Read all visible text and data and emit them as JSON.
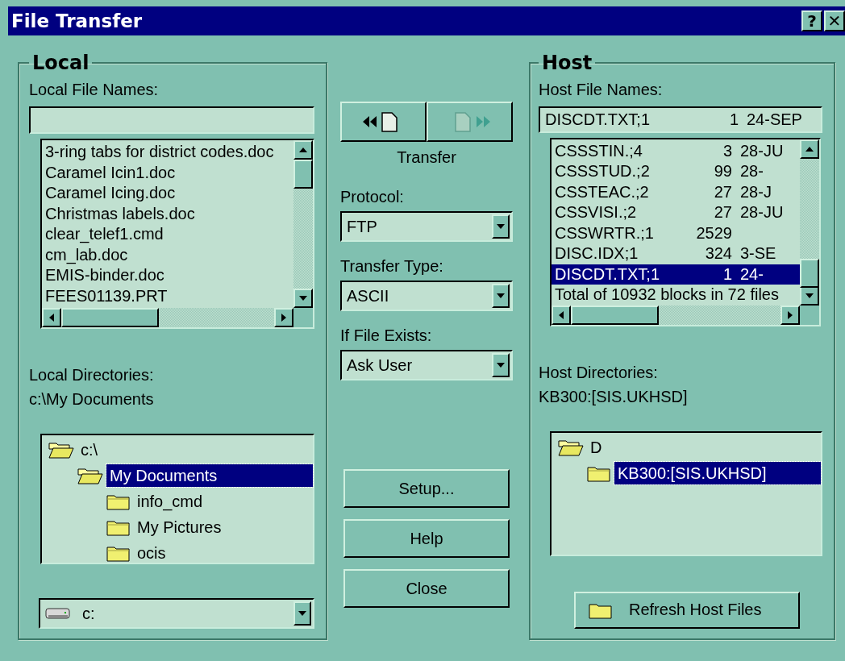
{
  "window": {
    "title": "File Transfer",
    "buttons": [
      "?",
      "✕"
    ]
  },
  "local": {
    "title": "Local",
    "file_names_label": "Local File Names:",
    "files": [
      {
        "name": "3-ring tabs for district codes.doc",
        "selected": false
      },
      {
        "name": "Caramel Icin1.doc",
        "selected": false
      },
      {
        "name": "Caramel Icing.doc",
        "selected": false
      },
      {
        "name": "Christmas labels.doc",
        "selected": false
      },
      {
        "name": "clear_telef1.cmd",
        "selected": false
      },
      {
        "name": "cm_lab.doc",
        "selected": false
      },
      {
        "name": "EMIS-binder.doc",
        "selected": false
      },
      {
        "name": "FEES01139.PRT",
        "selected": false
      }
    ],
    "directories_label": "Local Directories:",
    "current_directory": "c:\\My Documents",
    "tree": [
      {
        "name": "c:\\",
        "expanded": true,
        "selected": false,
        "children": [
          {
            "name": "My Documents",
            "expanded": true,
            "selected": true,
            "children": [
              {
                "name": "info_cmd",
                "expanded": false,
                "selected": false
              },
              {
                "name": "My Pictures",
                "expanded": false,
                "selected": false
              },
              {
                "name": "ocis",
                "expanded": false,
                "selected": false
              }
            ]
          }
        ]
      }
    ],
    "drive": "c:"
  },
  "middle": {
    "transfer_buttons": [
      {
        "kind": "download",
        "disabled": false
      },
      {
        "kind": "upload",
        "disabled": true
      }
    ],
    "transfer_label": "Transfer",
    "dropdowns": [
      {
        "label": "Protocol:",
        "value": "FTP"
      },
      {
        "label": "Transfer Type:",
        "value": "ASCII"
      },
      {
        "label": "If File Exists:",
        "value": "Ask User"
      }
    ],
    "buttons": [
      "Setup...",
      "Help",
      "Close"
    ]
  },
  "host": {
    "title": "Host",
    "file_names_label": "Host File Names:",
    "file_name_value": {
      "name": "DISCDT.TXT;1",
      "size": "1",
      "date": "24-SEP"
    },
    "files": [
      {
        "name": "CSSSTIN.;4",
        "size": "3",
        "date": "28-JU",
        "selected": false
      },
      {
        "name": "CSSSTUD.;2",
        "size": "99",
        "date": "28-",
        "selected": false
      },
      {
        "name": "CSSTEAC.;2",
        "size": "27",
        "date": "28-J",
        "selected": false
      },
      {
        "name": "CSSVISI.;2",
        "size": "27",
        "date": "28-JU",
        "selected": false
      },
      {
        "name": "CSSWRTR.;1",
        "size": "2529",
        "selected": false
      },
      {
        "name": "DISC.IDX;1",
        "size": "324",
        "date": "3-SE",
        "selected": false
      },
      {
        "name": "DISCDT.TXT;1",
        "size": "1",
        "date": "24-",
        "selected": true
      }
    ],
    "summary": "Total of 10932 blocks in 72 files",
    "directories_label": "Host Directories:",
    "current_directory": "KB300:[SIS.UKHSD]",
    "tree": [
      {
        "name": "D",
        "expanded": true,
        "selected": false,
        "children": [
          {
            "name": "KB300:[SIS.UKHSD]",
            "expanded": false,
            "selected": true
          }
        ]
      }
    ],
    "refresh_button": "Refresh Host Files"
  }
}
